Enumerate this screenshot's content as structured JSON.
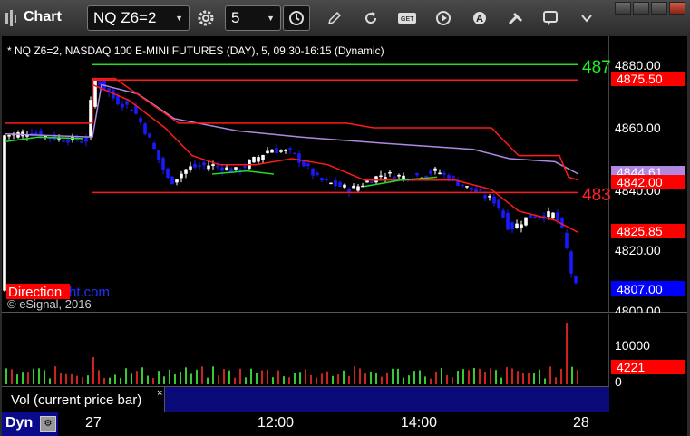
{
  "toolbar": {
    "app_title": "Chart",
    "symbol": "NQ Z6=2",
    "interval": "5"
  },
  "chart": {
    "header": "* NQ Z6=2, NASDAQ 100 E-MINI FUTURES (DAY), 5, 09:30-16:15 (Dynamic)",
    "watermark_brand_a": "Direction",
    "watermark_brand_b": "ht.com",
    "copyright": "© eSignal, 2016",
    "right_edge_green": "487",
    "right_edge_red": "483"
  },
  "price_axis": {
    "ticks": [
      "4880.00",
      "4860.00",
      "4840.00",
      "4820.00",
      "4800.00"
    ],
    "tag_upper": "4875.50",
    "tag_sma": "4844.61",
    "tag_lower": "4842.00",
    "tag_ema": "4825.85",
    "tag_last": "4807.00"
  },
  "volume_axis": {
    "ticks": [
      "10000",
      "0"
    ],
    "tag_last": "4221"
  },
  "volume_panel": {
    "label": "Vol (current price bar)",
    "close_glyph": "×"
  },
  "time_axis": {
    "dyn_label": "Dyn",
    "labels": [
      "27",
      "12:00",
      "14:00",
      "28"
    ]
  },
  "colors": {
    "up_candle": "#ffffff",
    "down_candle": "#1a1aff",
    "resistance": "#ff1a1a",
    "green_line": "#22dd22",
    "ema": "#ff1a1a",
    "sma": "#b088e0",
    "axis_tag_red": "#ff0000",
    "axis_tag_blue": "#0000ff"
  }
}
